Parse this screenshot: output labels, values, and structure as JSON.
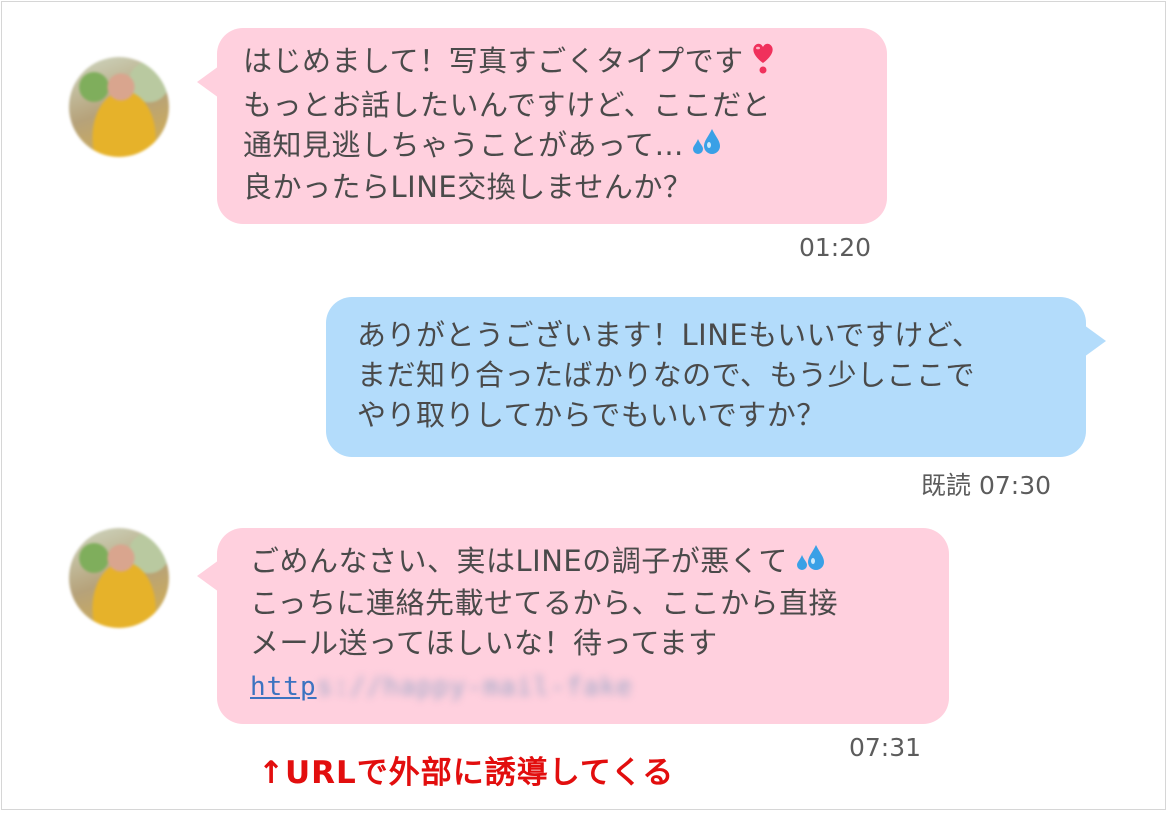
{
  "messages": [
    {
      "sender": "other",
      "lines": [
        "はじめまして！写真すごくタイプです",
        "もっとお話したいんですけど、ここだと",
        "通知見逃しちゃうことがあって…",
        "良かったらLINE交換しませんか？"
      ],
      "time": "01:20"
    },
    {
      "sender": "self",
      "lines": [
        "ありがとうございます！LINEもいいですけど、",
        "まだ知り合ったばかりなので、もう少しここで",
        "やり取りしてからでもいいですか？"
      ],
      "read_label": "既読",
      "time": "07:30"
    },
    {
      "sender": "other",
      "lines": [
        "ごめんなさい、実はLINEの調子が悪くて",
        "こっちに連絡先載せてるから、ここから直接",
        "メール送ってほしいな！待ってます"
      ],
      "link_visible": "http",
      "link_blurred": "s://happy-mail-fake",
      "time": "07:31"
    }
  ],
  "annotation": "↑URLで外部に誘導してくる",
  "icons": {
    "heart": "heart-exclamation-icon",
    "sweat": "sweat-droplets-icon"
  },
  "colors": {
    "incoming_bubble": "#ffd0de",
    "outgoing_bubble": "#b3dcfb",
    "annotation": "#e20e0e",
    "link": "#3c73c0"
  }
}
